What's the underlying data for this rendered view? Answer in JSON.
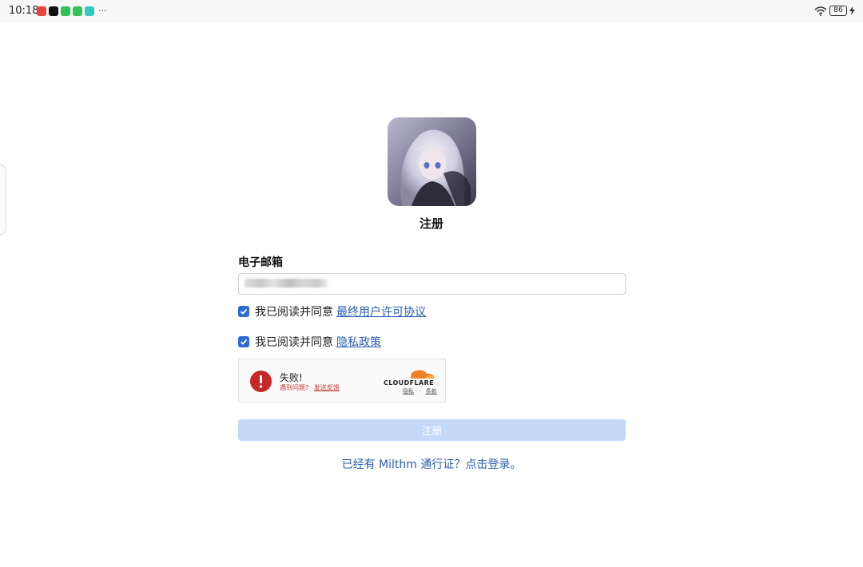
{
  "status_bar": {
    "time": "10:18",
    "more": "···",
    "battery": "86",
    "app_icons": [
      {
        "name": "red-app-icon",
        "color": "#e8453c"
      },
      {
        "name": "tiktok-icon",
        "color": "#111111"
      },
      {
        "name": "wechat-icon",
        "color": "#35c15a"
      },
      {
        "name": "wechat-icon",
        "color": "#35c15a"
      },
      {
        "name": "teal-app-icon",
        "color": "#33c9c0"
      }
    ]
  },
  "register": {
    "title": "注册",
    "email_label": "电子邮箱",
    "agree_eula_prefix": "我已阅读并同意",
    "agree_eula_link": "最终用户许可协议",
    "agree_privacy_prefix": "我已阅读并同意",
    "agree_privacy_link": "隐私政策",
    "submit_label": "注册",
    "login_prompt": "已经有 Milthm 通行证？点击登录。"
  },
  "captcha": {
    "status": "失败!",
    "problem_text": "遇到问题?",
    "feedback_link": "发送反馈",
    "brand": "CLOUDFLARE",
    "privacy_link": "隐私",
    "separator": "·",
    "terms_link": "条款"
  },
  "colors": {
    "accent": "#2f6bd4",
    "link": "#2a5db0",
    "button_disabled": "#c4d9f7",
    "error": "#c62828",
    "cloudflare_orange": "#f38020"
  }
}
